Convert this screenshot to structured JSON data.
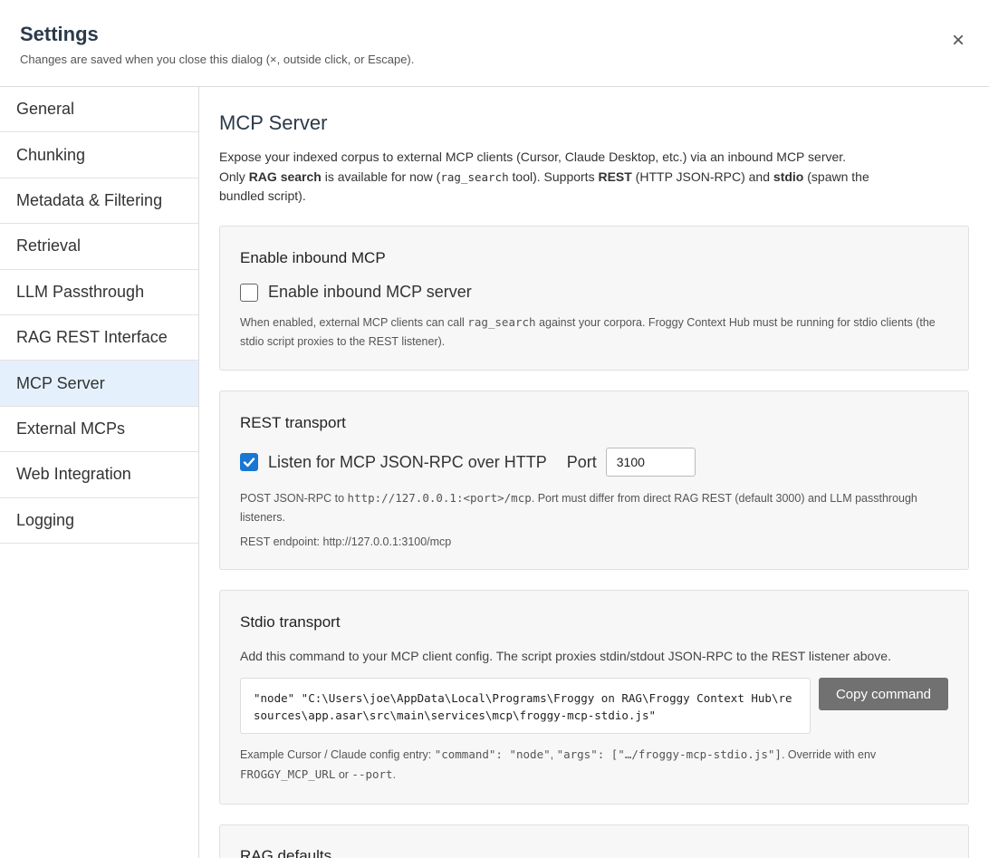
{
  "header": {
    "title": "Settings",
    "subtitle": "Changes are saved when you close this dialog (×, outside click, or Escape).",
    "close_label": "×"
  },
  "sidebar": {
    "items": [
      {
        "label": "General"
      },
      {
        "label": "Chunking"
      },
      {
        "label": "Metadata & Filtering"
      },
      {
        "label": "Retrieval"
      },
      {
        "label": "LLM Passthrough"
      },
      {
        "label": "RAG REST Interface"
      },
      {
        "label": "MCP Server",
        "active": true
      },
      {
        "label": "External MCPs"
      },
      {
        "label": "Web Integration"
      },
      {
        "label": "Logging"
      }
    ]
  },
  "main": {
    "title": "MCP Server",
    "intro": {
      "line1": "Expose your indexed corpus to external MCP clients (Cursor, Claude Desktop, etc.) via an inbound MCP server.",
      "p1": "Only ",
      "b1": "RAG search",
      "p2": " is available for now (",
      "c1": "rag_search",
      "p3": " tool). Supports ",
      "b2": "REST",
      "p4": " (HTTP JSON-RPC) and ",
      "b3": "stdio",
      "p5": " (spawn the bundled script)."
    },
    "enable_card": {
      "title": "Enable inbound MCP",
      "checkbox_label": "Enable inbound MCP server",
      "checked": false,
      "hint_p1": "When enabled, external MCP clients can call ",
      "hint_code": "rag_search",
      "hint_p2": " against your corpora. Froggy Context Hub must be running for stdio clients (the stdio script proxies to the REST listener)."
    },
    "rest_card": {
      "title": "REST transport",
      "checkbox_label": "Listen for MCP JSON-RPC over HTTP",
      "checked": true,
      "port_label": "Port",
      "port_value": "3100",
      "hint_p1": "POST JSON-RPC to ",
      "hint_code": "http://127.0.0.1:<port>/mcp",
      "hint_p2": ". Port must differ from direct RAG REST (default 3000) and LLM passthrough listeners.",
      "endpoint": "REST endpoint: http://127.0.0.1:3100/mcp"
    },
    "stdio_card": {
      "title": "Stdio transport",
      "description": "Add this command to your MCP client config. The script proxies stdin/stdout JSON-RPC to the REST listener above.",
      "command": "\"node\" \"C:\\Users\\joe\\AppData\\Local\\Programs\\Froggy on RAG\\Froggy Context Hub\\resources\\app.asar\\src\\main\\services\\mcp\\froggy-mcp-stdio.js\"",
      "copy_label": "Copy command",
      "ex_p1": "Example Cursor / Claude config entry: ",
      "ex_c1": "\"command\": \"node\"",
      "ex_p2": ", ",
      "ex_c2": "\"args\": [\"…/froggy-mcp-stdio.js\"]",
      "ex_p3": ". Override with env ",
      "ex_c3": "FROGGY_MCP_URL",
      "ex_p4": " or ",
      "ex_c4": "--port",
      "ex_p5": "."
    },
    "rag_card": {
      "title": "RAG defaults"
    }
  }
}
